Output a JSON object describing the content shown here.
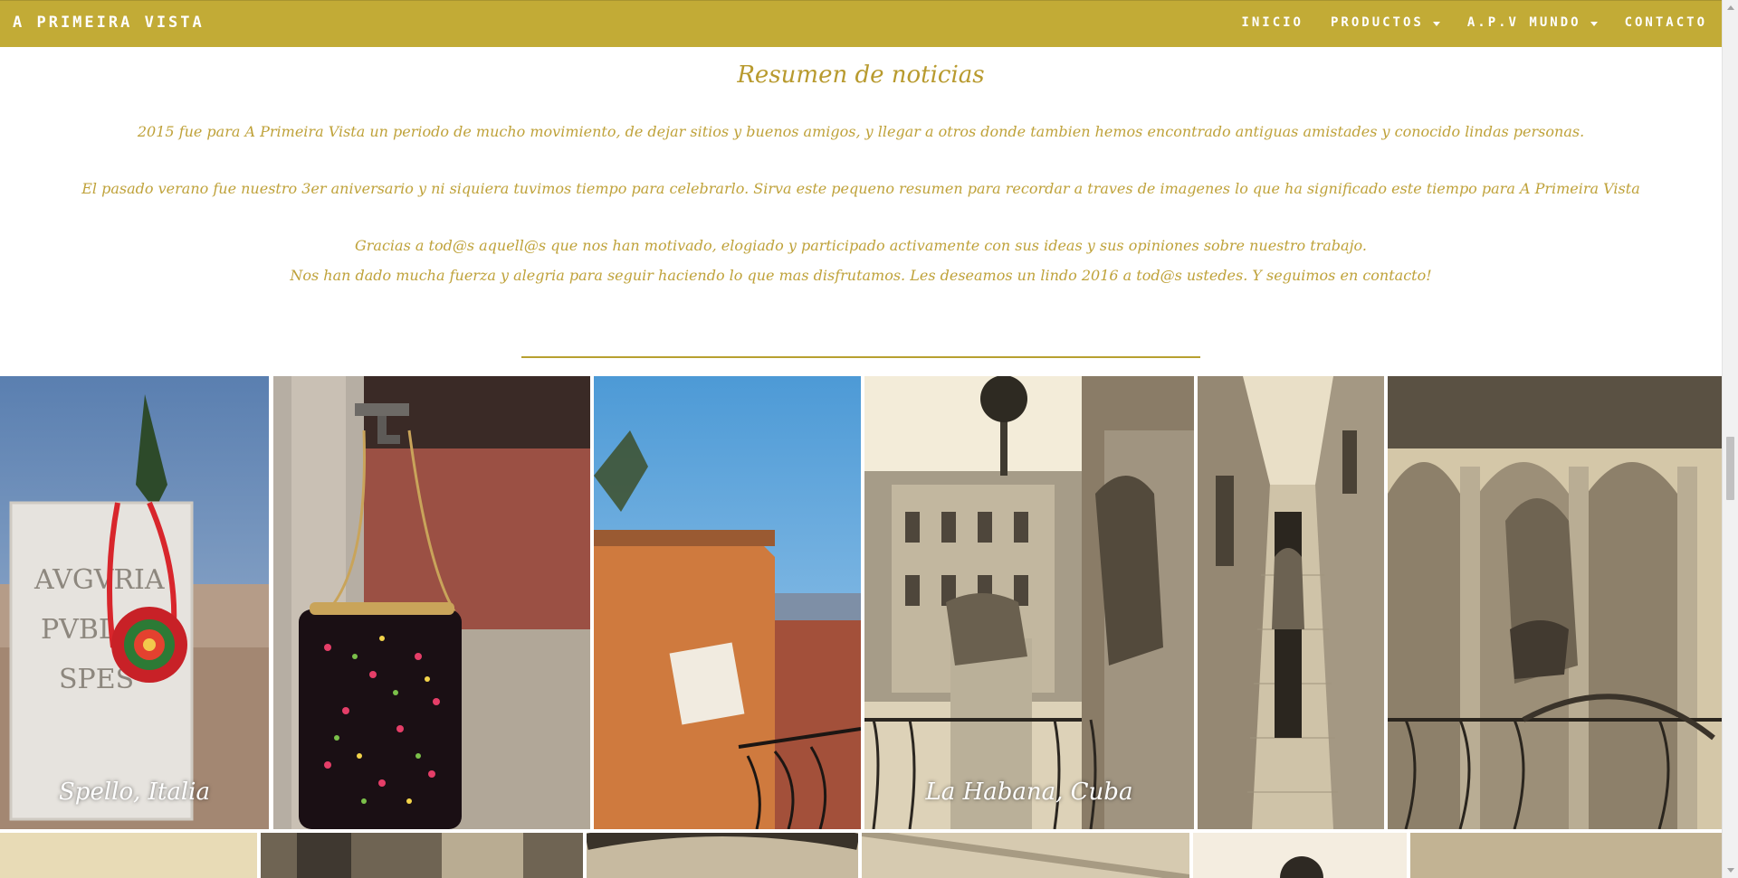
{
  "brand": "A PRIMEIRA VISTA",
  "nav": {
    "inicio": "INICIO",
    "productos": "PRODUCTOS",
    "apv_mundo": "A.P.V MUNDO",
    "contacto": "CONTACTO"
  },
  "news": {
    "title": "Resumen de noticias",
    "p1": "2015 fue para A Primeira Vista un periodo de mucho movimiento, de dejar sitios y buenos amigos, y llegar a otros donde tambien hemos encontrado antiguas amistades y conocido lindas personas.",
    "p2": "El pasado verano fue nuestro 3er aniversario y ni siquiera tuvimos tiempo para celebrarlo. Sirva este pequeno resumen para recordar a traves de imagenes lo que ha significado este tiempo para A Primeira Vista",
    "p3": "Gracias a tod@s aquell@s que nos han motivado, elogiado y participado activamente con sus ideas y sus opiniones sobre nuestro trabajo.",
    "p4": "Nos han dado mucha fuerza y alegria para seguir haciendo lo que mas disfrutamos. Les deseamos un lindo 2016 a tod@s ustedes. Y seguimos en contacto!"
  },
  "gallery": {
    "caption_spello": "Spello, Italia",
    "caption_habana": "La Habana, Cuba"
  },
  "colors": {
    "nav_bg": "#c2ab36",
    "accent_text": "#bfa23a"
  }
}
